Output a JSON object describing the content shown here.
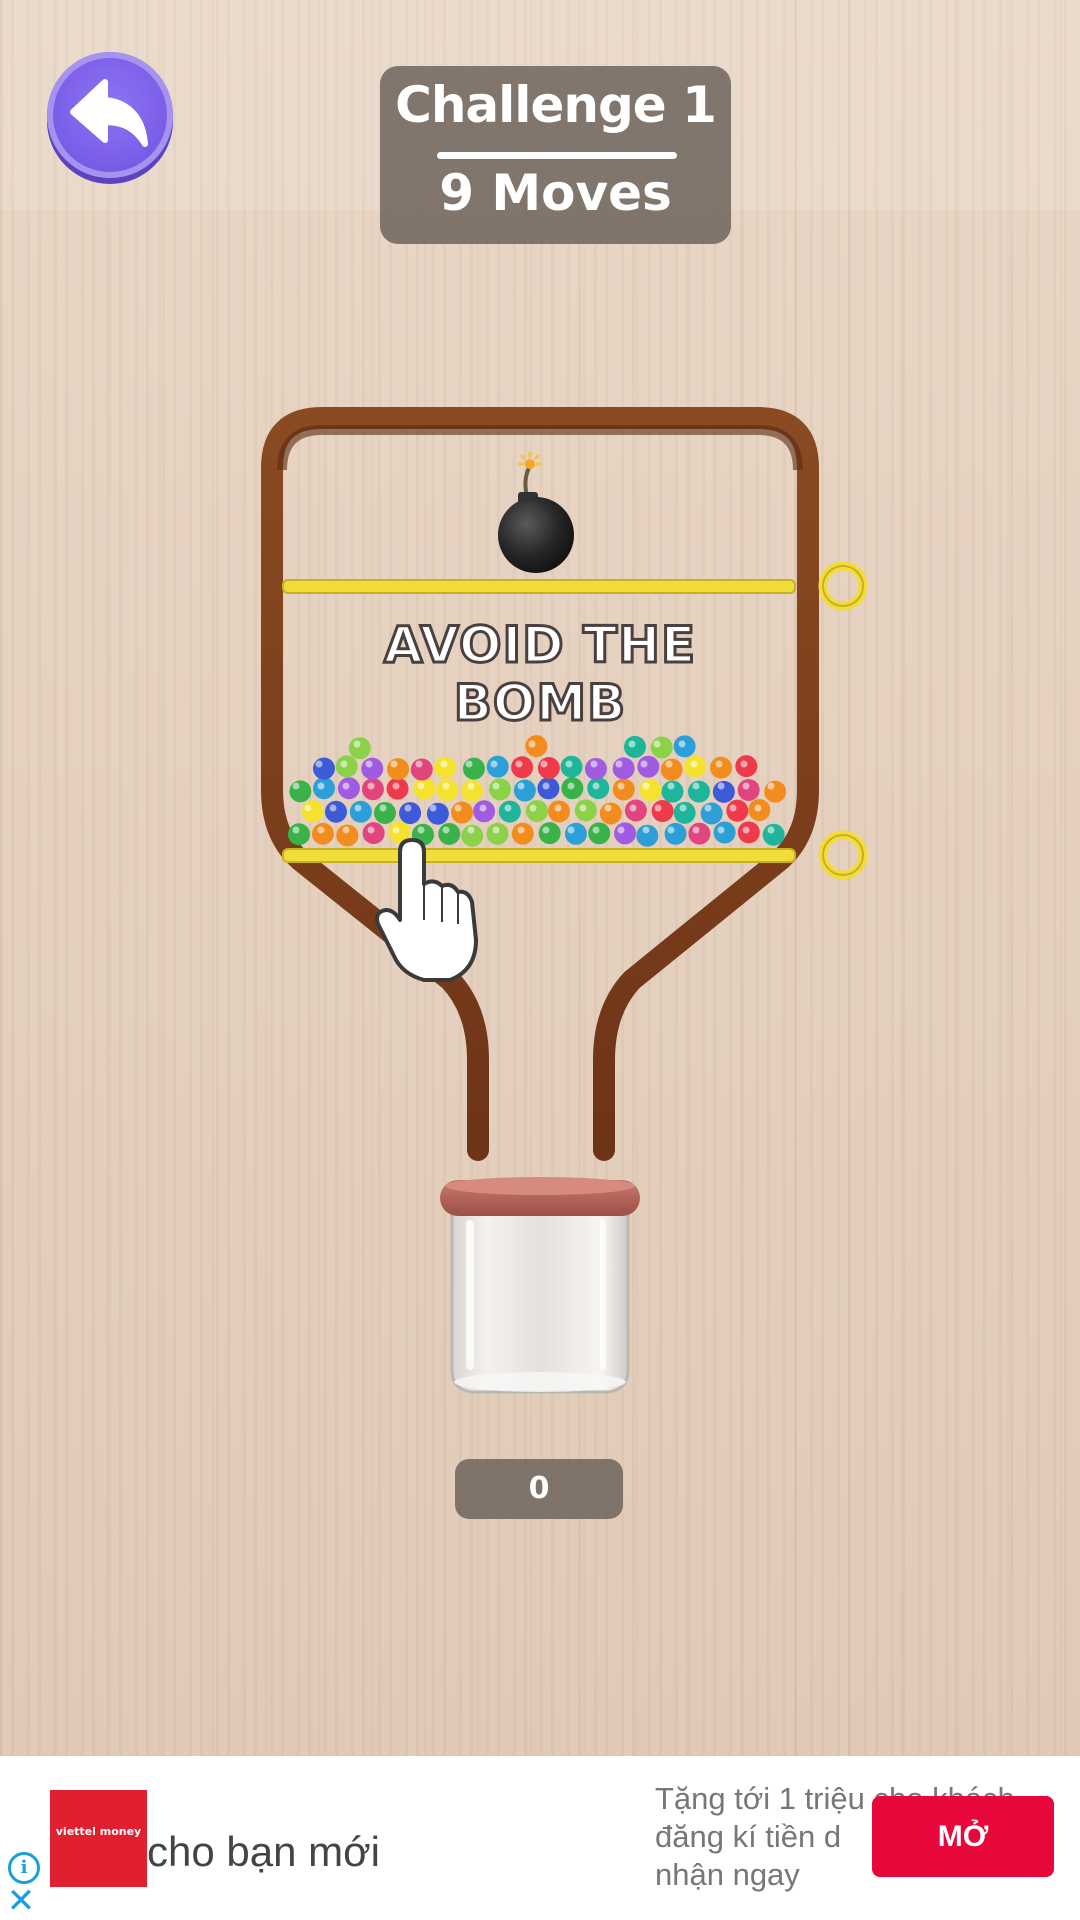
{
  "header": {
    "back_icon": "back-arrow-icon",
    "level_title": "Challenge 1",
    "moves_label": "9 Moves"
  },
  "board": {
    "hint_text": "AVOID THE BOMB",
    "bomb_icon": "bomb-icon",
    "hand_icon": "pointing-hand-icon",
    "pin_color": "#f2dc3c",
    "frame_color": "#7a3a1a",
    "ball_colors": [
      "#ee3b4b",
      "#3ab24a",
      "#2d9fd8",
      "#a05ce0",
      "#f5e22e",
      "#f28c1f",
      "#1fb59a",
      "#e0457e",
      "#3d5ad8",
      "#8bd24a"
    ],
    "balls_collected": "0"
  },
  "ad": {
    "brand_logo_text": "viettel money",
    "headline": "cho bạn mới",
    "description": "Tặng tới 1 triệu cho khách\nđăng kí tiền d\nnhận ngay",
    "cta": "MỞ",
    "info_icon": "info-icon",
    "close_icon": "close-icon"
  }
}
